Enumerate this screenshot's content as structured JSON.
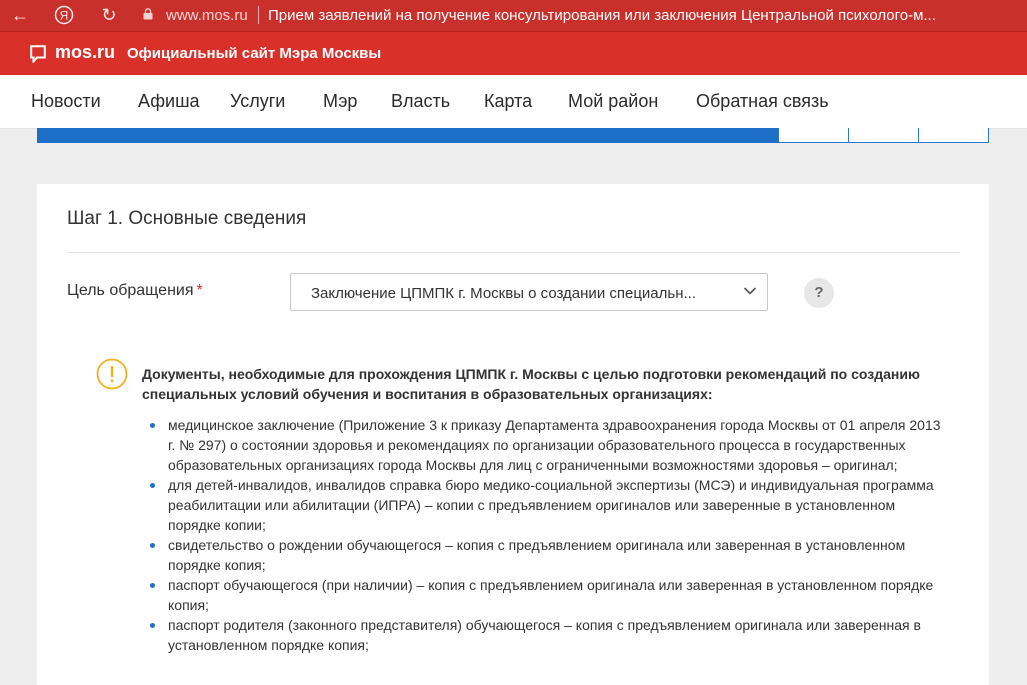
{
  "browser": {
    "url": "www.mos.ru",
    "tab_title": "Прием заявлений на получение консультирования или заключения Центральной психолого-м..."
  },
  "mos_header": {
    "brand": "mos.ru",
    "tagline": "Официальный сайт Мэра Москвы"
  },
  "nav": {
    "items": [
      "Новости",
      "Афиша",
      "Услуги",
      "Мэр",
      "Власть",
      "Карта",
      "Мой район",
      "Обратная связь"
    ]
  },
  "progress": {
    "completed_fraction": 0.78,
    "steps_total": 4,
    "steps_done": 1
  },
  "form": {
    "step_title": "Шаг 1. Основные сведения",
    "purpose_label": "Цель обращения",
    "required_mark": "*",
    "purpose_value": "Заключение ЦПМПК г. Москвы о создании специальн...",
    "help_label": "?"
  },
  "info": {
    "title": "Документы, необходимые для прохождения ЦПМПК г. Москвы с целью подготовки рекомендаций по созданию специальных условий обучения и воспитания в образовательных организациях:",
    "items": [
      "медицинское заключение (Приложение 3 к приказу Департамента здравоохранения города Москвы от 01 апреля 2013 г. № 297) о состоянии здоровья и рекомендациях по организации образовательного процесса в государственных образовательных организациях города Москвы для лиц с ограниченными возможностями здоровья – оригинал;",
      "для детей-инвалидов, инвалидов справка бюро медико-социальной экспертизы (МСЭ) и индивидуальная программа реабилитации или абилитации (ИПРА) – копии с предъявлением оригиналов или заверенные в установленном порядке копии;",
      "свидетельство о рождении обучающегося – копия с предъявлением оригинала или заверенная в установленном порядке копия;",
      "паспорт обучающегося (при наличии) – копия с предъявлением оригинала или заверенная в установленном порядке копия;",
      "паспорт родителя (законного представителя) обучающегося – копия с предъявлением оригинала или заверенная в установленном порядке копия;"
    ]
  },
  "colors": {
    "brand_red": "#d9302a",
    "accent_blue": "#1e6fc8",
    "warning": "#f2b01e"
  }
}
